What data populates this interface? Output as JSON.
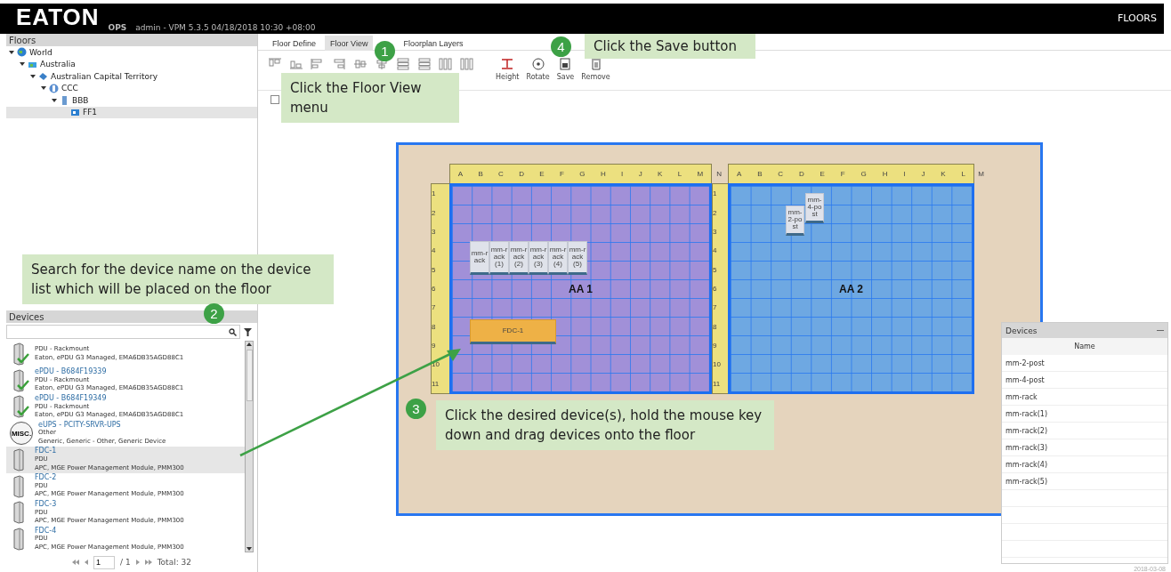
{
  "header": {
    "logo": "EATON",
    "app_label": "OPS",
    "session": "admin - VPM 5.3.5  04/18/2018 10:30 +08:00",
    "section": "FLOORS"
  },
  "floors_panel": {
    "title": "Floors",
    "tree": [
      {
        "label": "World",
        "kind": "globe",
        "expanded": true,
        "selected": false,
        "children": [
          {
            "label": "Australia",
            "kind": "country",
            "expanded": true,
            "selected": false,
            "children": [
              {
                "label": "Australian Capital Territory",
                "kind": "region",
                "expanded": true,
                "selected": false,
                "children": [
                  {
                    "label": "CCC",
                    "kind": "site",
                    "expanded": true,
                    "selected": false,
                    "children": [
                      {
                        "label": "BBB",
                        "kind": "building",
                        "expanded": true,
                        "selected": false,
                        "children": [
                          {
                            "label": "FF1",
                            "kind": "floor",
                            "selected": true
                          }
                        ]
                      }
                    ]
                  }
                ]
              }
            ]
          }
        ]
      }
    ]
  },
  "devices_panel": {
    "title": "Devices",
    "items": [
      {
        "type": "PDU - Rackmount",
        "description": "Eaton, ePDU G3 Managed, EMA6DB35AGD88C1",
        "kind": "pdu_ok",
        "selected": false
      },
      {
        "name": "ePDU - B684F19339",
        "type": "PDU - Rackmount",
        "description": "Eaton, ePDU G3 Managed, EMA6DB35AGD88C1",
        "kind": "pdu_ok",
        "selected": false
      },
      {
        "name": "ePDU - B684F19349",
        "type": "PDU - Rackmount",
        "description": "Eaton, ePDU G3 Managed, EMA6DB35AGD88C1",
        "kind": "pdu_ok",
        "selected": false
      },
      {
        "name": "eUPS - PCITY-SRVR-UPS",
        "type": "Other",
        "description": "Generic, Generic - Other, Generic Device",
        "kind": "misc",
        "badge": "MISC.",
        "selected": false
      },
      {
        "name": "FDC-1",
        "type": "PDU",
        "description": "APC, MGE Power Management Module, PMM300",
        "kind": "pdu",
        "selected": true
      },
      {
        "name": "FDC-2",
        "type": "PDU",
        "description": "APC, MGE Power Management Module, PMM300",
        "kind": "pdu",
        "selected": false
      },
      {
        "name": "FDC-3",
        "type": "PDU",
        "description": "APC, MGE Power Management Module, PMM300",
        "kind": "pdu",
        "selected": false
      },
      {
        "name": "FDC-4",
        "type": "PDU",
        "description": "APC, MGE Power Management Module, PMM300",
        "kind": "pdu",
        "selected": false
      }
    ],
    "pager": {
      "page": "1",
      "pages": "/ 1",
      "total": "Total: 32"
    }
  },
  "tabs": [
    {
      "label": "Floor Define",
      "selected": false
    },
    {
      "label": "Floor View",
      "selected": true
    },
    {
      "label": "Floorplan Layers",
      "selected": false
    }
  ],
  "toolbar": [
    {
      "kind": "align_top"
    },
    {
      "kind": "align_bottom"
    },
    {
      "kind": "align_left"
    },
    {
      "kind": "align_right"
    },
    {
      "kind": "center_h"
    },
    {
      "kind": "center_v"
    },
    {
      "kind": "rows"
    },
    {
      "kind": "rows"
    },
    {
      "kind": "cols"
    },
    {
      "kind": "cols"
    },
    {
      "kind": "height",
      "label": "Height"
    },
    {
      "kind": "rotate",
      "label": "Rotate"
    },
    {
      "kind": "save",
      "label": "Save"
    },
    {
      "kind": "remove",
      "label": "Remove"
    }
  ],
  "show_option": {
    "checked": false
  },
  "floor": {
    "zones": [
      {
        "name": "AA 1",
        "color": "#a190d8",
        "columns": [
          "A",
          "B",
          "C",
          "D",
          "E",
          "F",
          "G",
          "H",
          "I",
          "J",
          "K",
          "L",
          "M"
        ],
        "trailing_column": "N",
        "rows": [
          "1",
          "2",
          "3",
          "4",
          "5",
          "6",
          "7",
          "8",
          "9",
          "10",
          "11"
        ],
        "devices": [
          {
            "label": "mm-rack",
            "kind": "rack"
          },
          {
            "label": "mm-rack(1)",
            "kind": "rack"
          },
          {
            "label": "mm-rack(2)",
            "kind": "rack"
          },
          {
            "label": "mm-rack(3)",
            "kind": "rack"
          },
          {
            "label": "mm-rack(4)",
            "kind": "rack"
          },
          {
            "label": "mm-rack(5)",
            "kind": "rack"
          },
          {
            "label": "FDC-1",
            "kind": "pdu"
          }
        ]
      },
      {
        "name": "AA 2",
        "color": "#6ea8e2",
        "columns": [
          "A",
          "B",
          "C",
          "D",
          "E",
          "F",
          "G",
          "H",
          "I",
          "J",
          "K",
          "L"
        ],
        "trailing_column": "M",
        "rows": [
          "1",
          "2",
          "3",
          "4",
          "5",
          "6",
          "7",
          "8",
          "9",
          "10",
          "11"
        ],
        "devices": [
          {
            "label": "mm-2-post",
            "kind": "rack"
          },
          {
            "label": "mm-4-post",
            "kind": "rack"
          }
        ]
      }
    ]
  },
  "placed_devices": {
    "title": "Devices",
    "column": "Name",
    "rows": [
      "mm-2-post",
      "mm-4-post",
      "mm-rack",
      "mm-rack(1)",
      "mm-rack(2)",
      "mm-rack(3)",
      "mm-rack(4)",
      "mm-rack(5)"
    ]
  },
  "callouts": [
    {
      "number": "1",
      "text": "Click the Floor View menu"
    },
    {
      "number": "4",
      "text": "Click the Save button"
    },
    {
      "number": "2",
      "text": "Search for the device name on the device list which will be placed on the floor"
    },
    {
      "number": "3",
      "text": "Click the desired device(s), hold the mouse key down and drag devices onto the floor"
    }
  ],
  "footer": {
    "date": "2018-03-08"
  }
}
